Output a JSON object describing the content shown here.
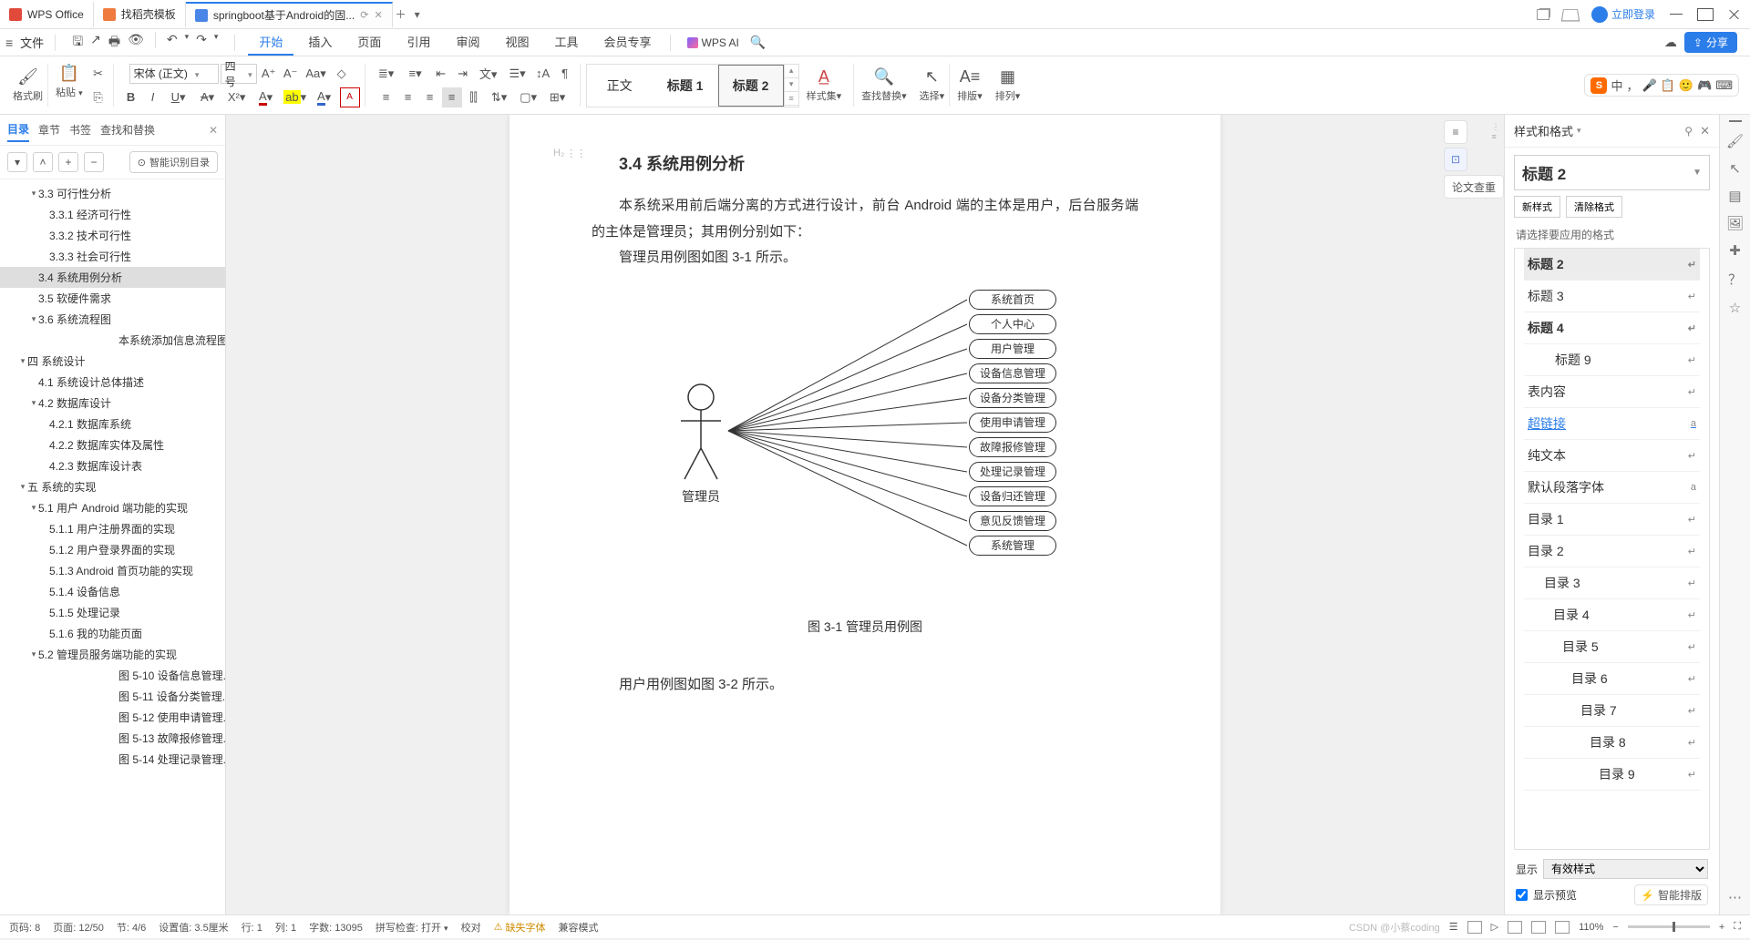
{
  "titlebar": {
    "tabs": [
      {
        "label": "WPS Office",
        "icon_color": "ico-red"
      },
      {
        "label": "找稻壳模板",
        "icon_color": "ico-orange"
      },
      {
        "label": "springboot基于Android的固...",
        "icon_color": "ico-blue",
        "active": true
      }
    ],
    "login": "立即登录"
  },
  "menubar": {
    "file": "文件",
    "tabs": [
      "开始",
      "插入",
      "页面",
      "引用",
      "审阅",
      "视图",
      "工具",
      "会员专享"
    ],
    "active_tab": "开始",
    "ai": "WPS AI",
    "share": "分享"
  },
  "ribbon": {
    "format_painter": "格式刷",
    "paste": "粘贴",
    "font_name": "宋体 (正文)",
    "font_size": "四号",
    "styles": {
      "normal": "正文",
      "h1": "标题 1",
      "h2": "标题 2"
    },
    "style_set": "样式集",
    "find_replace": "查找替换",
    "select": "选择",
    "sort": "排版",
    "arrange": "排列",
    "ime": {
      "mode": "中",
      "items": [
        "🎤",
        "📋",
        "🙂",
        "🎮",
        "⌨"
      ]
    }
  },
  "outline": {
    "tabs": {
      "toc": "目录",
      "chapter": "章节",
      "bookmark": "书签",
      "find": "查找和替换"
    },
    "smart_toc": "智能识别目录",
    "items": [
      {
        "lvl": 2,
        "caret": "▾",
        "text": "3.3 可行性分析"
      },
      {
        "lvl": 3,
        "text": "3.3.1 经济可行性"
      },
      {
        "lvl": 3,
        "text": "3.3.2 技术可行性"
      },
      {
        "lvl": 3,
        "text": "3.3.3 社会可行性"
      },
      {
        "lvl": 2,
        "text": "3.4 系统用例分析",
        "sel": true
      },
      {
        "lvl": 2,
        "text": "3.5 软硬件需求"
      },
      {
        "lvl": 2,
        "caret": "▾",
        "text": "3.6 系统流程图"
      },
      {
        "lvl": 5,
        "text": "本系统添加信息流程图..."
      },
      {
        "lvl": 1,
        "caret": "▾",
        "text": "四 系统设计"
      },
      {
        "lvl": 2,
        "text": "4.1 系统设计总体描述"
      },
      {
        "lvl": 2,
        "caret": "▾",
        "text": "4.2 数据库设计"
      },
      {
        "lvl": 3,
        "text": "4.2.1 数据库系统"
      },
      {
        "lvl": 3,
        "text": "4.2.2 数据库实体及属性"
      },
      {
        "lvl": 3,
        "text": "4.2.3 数据库设计表"
      },
      {
        "lvl": 1,
        "caret": "▾",
        "text": "五 系统的实现"
      },
      {
        "lvl": 2,
        "caret": "▾",
        "text": "5.1  用户 Android 端功能的实现"
      },
      {
        "lvl": 3,
        "text": "5.1.1 用户注册界面的实现"
      },
      {
        "lvl": 3,
        "text": "5.1.2 用户登录界面的实现"
      },
      {
        "lvl": 3,
        "text": "5.1.3 Android 首页功能的实现"
      },
      {
        "lvl": 3,
        "text": "5.1.4 设备信息"
      },
      {
        "lvl": 3,
        "text": "5.1.5 处理记录"
      },
      {
        "lvl": 3,
        "text": "5.1.6 我的功能页面"
      },
      {
        "lvl": 2,
        "caret": "▾",
        "text": "5.2  管理员服务端功能的实现"
      },
      {
        "lvl": 5,
        "text": "图 5-10 设备信息管理..."
      },
      {
        "lvl": 5,
        "text": "图 5-11 设备分类管理..."
      },
      {
        "lvl": 5,
        "text": "图 5-12 使用申请管理..."
      },
      {
        "lvl": 5,
        "text": "图 5-13 故障报修管理..."
      },
      {
        "lvl": 5,
        "text": "图 5-14 处理记录管理..."
      }
    ]
  },
  "doc": {
    "heading": "3.4 系统用例分析",
    "para1": "本系统采用前后端分离的方式进行设计，前台 Android 端的主体是用户，后台服务端的主体是管理员；其用例分别如下：",
    "para2": "管理员用例图如图 3-1 所示。",
    "actor": "管理员",
    "cases": [
      "系统首页",
      "个人中心",
      "用户管理",
      "设备信息管理",
      "设备分类管理",
      "使用申请管理",
      "故障报修管理",
      "处理记录管理",
      "设备归还管理",
      "意见反馈管理",
      "系统管理"
    ],
    "caption": "图 3-1  管理员用例图",
    "para3": "用户用例图如图 3-2 所示。",
    "paper_check": "论文查重"
  },
  "styles_panel": {
    "title": "样式和格式",
    "current": "标题 2",
    "btn_new": "新样式",
    "btn_clear": "清除格式",
    "prompt": "请选择要应用的格式",
    "list": [
      {
        "text": "标题 2",
        "cls": "b sel",
        "indent": 0
      },
      {
        "text": "标题 3",
        "cls": "",
        "indent": 0
      },
      {
        "text": "标题 4",
        "cls": "b",
        "indent": 0
      },
      {
        "text": "标题 9",
        "cls": "",
        "indent": 30
      },
      {
        "text": "表内容",
        "cls": "",
        "indent": 0
      },
      {
        "text": "超链接",
        "cls": "link",
        "indent": 0,
        "mark": "a"
      },
      {
        "text": "纯文本",
        "cls": "",
        "indent": 0
      },
      {
        "text": "默认段落字体",
        "cls": "",
        "indent": 0,
        "mark": "a"
      },
      {
        "text": "目录 1",
        "cls": "",
        "indent": 0
      },
      {
        "text": "目录 2",
        "cls": "",
        "indent": 0
      },
      {
        "text": "目录 3",
        "cls": "",
        "indent": 18
      },
      {
        "text": "目录 4",
        "cls": "",
        "indent": 28
      },
      {
        "text": "目录 5",
        "cls": "",
        "indent": 38
      },
      {
        "text": "目录 6",
        "cls": "",
        "indent": 48
      },
      {
        "text": "目录 7",
        "cls": "",
        "indent": 58
      },
      {
        "text": "目录 8",
        "cls": "",
        "indent": 68
      },
      {
        "text": "目录 9",
        "cls": "",
        "indent": 78
      }
    ],
    "show_label": "显示",
    "show_value": "有效样式",
    "preview": "显示预览",
    "auto_layout": "智能排版"
  },
  "status": {
    "page_no": "页码: 8",
    "pages": "页面: 12/50",
    "section": "节: 4/6",
    "indent": "设置值: 3.5厘米",
    "row": "行: 1",
    "col": "列: 1",
    "words": "字数: 13095",
    "spell": "拼写检查: 打开",
    "proof": "校对",
    "missing_font": "缺失字体",
    "compat": "兼容模式",
    "zoom": "110%",
    "watermark": "CSDN @小蔡coding"
  }
}
